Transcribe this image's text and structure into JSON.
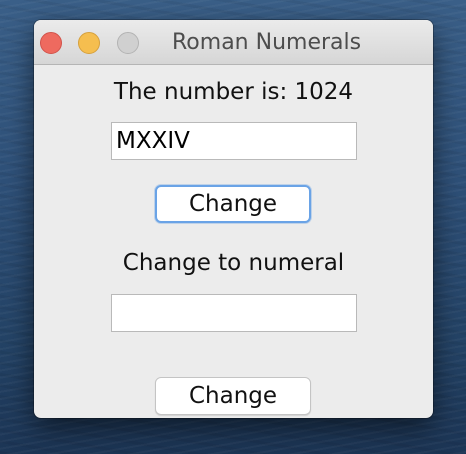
{
  "window": {
    "title": "Roman Numerals"
  },
  "form": {
    "number_label": "The number is: 1024",
    "roman_value": "MXXIV",
    "change_button_1": "Change",
    "numeral_label": "Change to numeral",
    "number_value": "",
    "change_button_2": "Change"
  },
  "colors": {
    "close": "#ee6a5f",
    "minimize": "#f5be4f",
    "zoom_inactive": "#d0d0d0",
    "focus_ring": "#6aa3e6"
  },
  "icons": {
    "close": "close-icon",
    "minimize": "minimize-icon",
    "zoom": "zoom-icon"
  }
}
